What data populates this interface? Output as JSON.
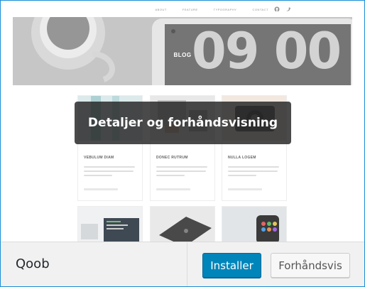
{
  "theme_nav": {
    "links": [
      "ABOUT",
      "FEATURE",
      "TYPOGRAPHY",
      "CONTACT"
    ],
    "icons": [
      "github-icon",
      "twitter-icon"
    ]
  },
  "hero": {
    "title": "BLOG",
    "tablet_text": "09 00"
  },
  "posts": [
    {
      "title": "VEBULUM DIAM"
    },
    {
      "title": "DONEC RUTRUM"
    },
    {
      "title": "NULLA LOGEM"
    }
  ],
  "overlay": {
    "text": "Detaljer og forhåndsvisning"
  },
  "footer": {
    "theme_name": "Qoob",
    "install_label": "Installer",
    "preview_label": "Forhåndsvis"
  },
  "colors": {
    "frame_border": "#1b8fd6",
    "primary_button": "#0085ba",
    "footer_background": "#f1f1f1"
  }
}
